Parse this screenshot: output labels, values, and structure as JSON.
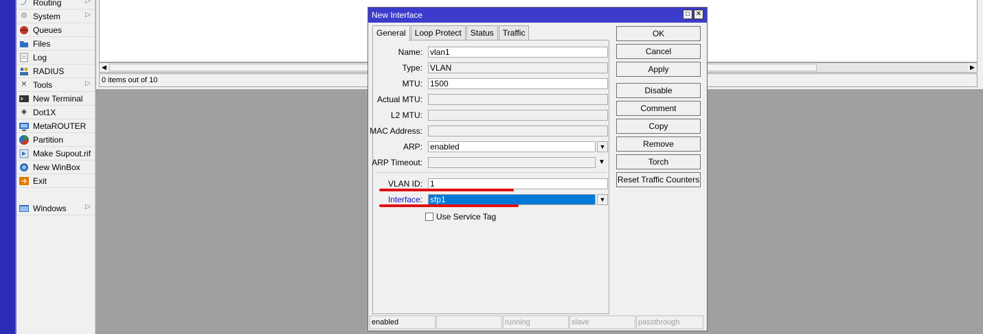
{
  "sidebar": {
    "items": [
      {
        "label": "Routing",
        "icon": "routing-icon",
        "submenu": true
      },
      {
        "label": "System",
        "icon": "gear-icon",
        "submenu": true
      },
      {
        "label": "Queues",
        "icon": "queues-icon",
        "submenu": false
      },
      {
        "label": "Files",
        "icon": "folder-icon",
        "submenu": false
      },
      {
        "label": "Log",
        "icon": "log-icon",
        "submenu": false
      },
      {
        "label": "RADIUS",
        "icon": "radius-icon",
        "submenu": false
      },
      {
        "label": "Tools",
        "icon": "tools-icon",
        "submenu": true
      },
      {
        "label": "New Terminal",
        "icon": "terminal-icon",
        "submenu": false
      },
      {
        "label": "Dot1X",
        "icon": "dot1x-icon",
        "submenu": false
      },
      {
        "label": "MetaROUTER",
        "icon": "metarouter-icon",
        "submenu": false
      },
      {
        "label": "Partition",
        "icon": "partition-icon",
        "submenu": false
      },
      {
        "label": "Make Supout.rif",
        "icon": "supout-icon",
        "submenu": false
      },
      {
        "label": "New WinBox",
        "icon": "winbox-icon",
        "submenu": false
      },
      {
        "label": "Exit",
        "icon": "exit-icon",
        "submenu": false
      },
      {
        "label": "Windows",
        "icon": "windows-icon",
        "submenu": true
      }
    ]
  },
  "list": {
    "status_text": "0 items out of 10"
  },
  "dialog": {
    "title": "New Interface",
    "tabs": [
      "General",
      "Loop Protect",
      "Status",
      "Traffic"
    ],
    "fields": {
      "name": {
        "label": "Name:",
        "value": "vlan1"
      },
      "type": {
        "label": "Type:",
        "value": "VLAN"
      },
      "mtu": {
        "label": "MTU:",
        "value": "1500"
      },
      "actual_mtu": {
        "label": "Actual MTU:",
        "value": ""
      },
      "l2_mtu": {
        "label": "L2 MTU:",
        "value": ""
      },
      "mac_address": {
        "label": "MAC Address:",
        "value": ""
      },
      "arp": {
        "label": "ARP:",
        "value": "enabled"
      },
      "arp_timeout": {
        "label": "ARP Timeout:",
        "value": ""
      },
      "vlan_id": {
        "label": "VLAN ID:",
        "value": "1"
      },
      "interface": {
        "label": "Interface:",
        "value": "sfp1"
      },
      "use_service_tag": {
        "label": "Use Service Tag",
        "checked": false
      }
    },
    "buttons": [
      "OK",
      "Cancel",
      "Apply",
      "Disable",
      "Comment",
      "Copy",
      "Remove",
      "Torch",
      "Reset Traffic Counters"
    ],
    "status_bar": [
      "enabled",
      "",
      "running",
      "slave",
      "passthrough"
    ]
  },
  "colors": {
    "titlebar": "#3c3ccc",
    "highlight": "#0078d7",
    "annotation_underline": "#e01010",
    "interface_label": "#1010c0"
  }
}
